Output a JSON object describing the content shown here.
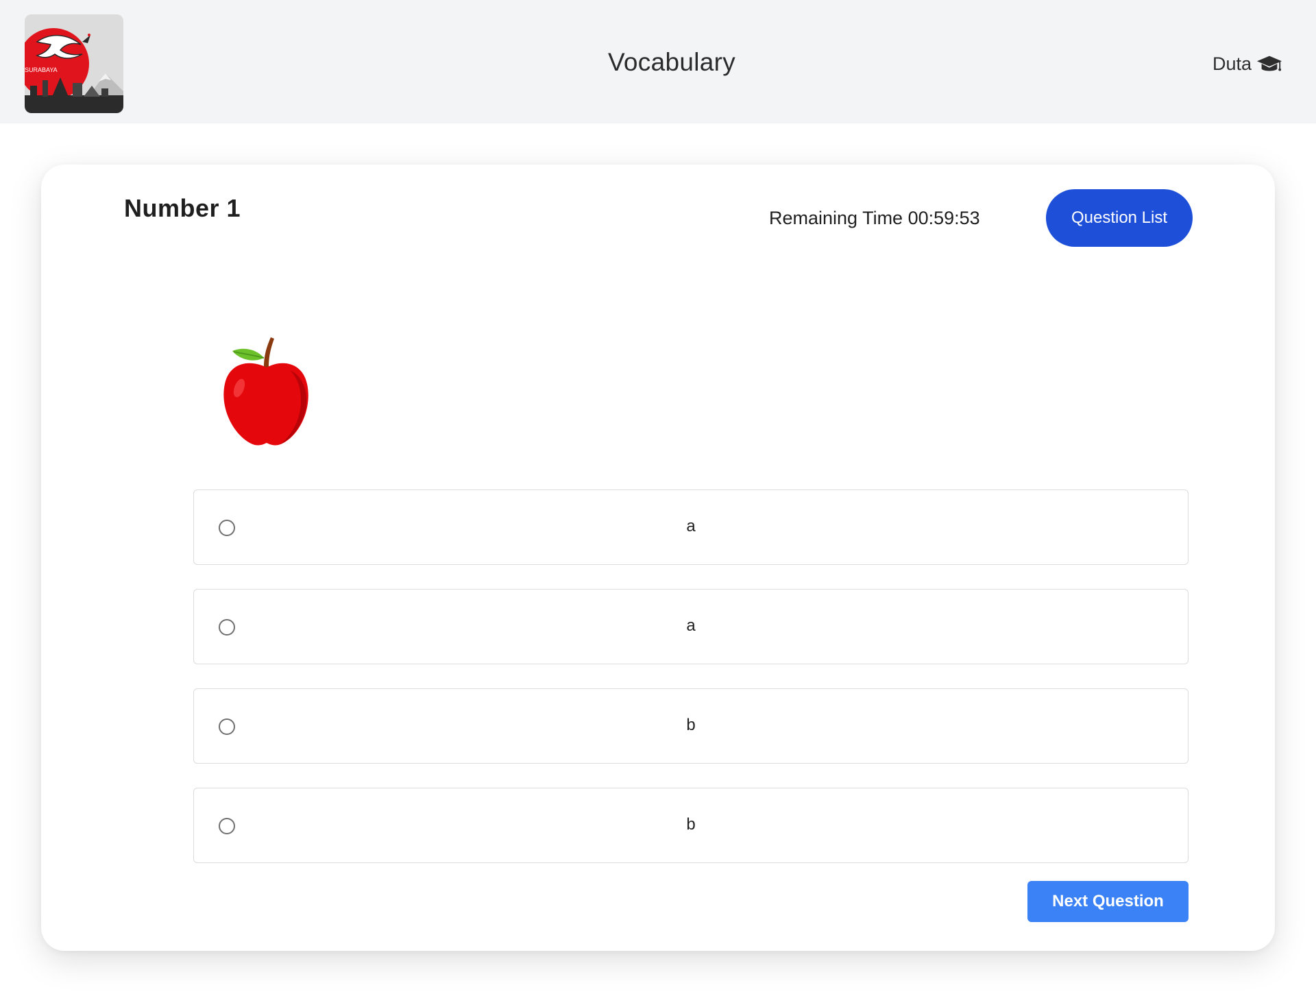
{
  "header": {
    "logo_text": "SURABAYA",
    "title": "Vocabulary",
    "user_name": "Duta",
    "user_icon": "graduation-cap-icon"
  },
  "quiz": {
    "number_label": "Number 1",
    "timer_label": "Remaining Time 00:59:53",
    "question_list_label": "Question List",
    "image_icon": "apple-image",
    "options": [
      {
        "label": "a",
        "selected": false
      },
      {
        "label": "a",
        "selected": false
      },
      {
        "label": "b",
        "selected": false
      },
      {
        "label": "b",
        "selected": false
      }
    ],
    "next_label": "Next Question"
  },
  "colors": {
    "header_bg": "#f3f4f6",
    "question_list_button": "#1d4fd8",
    "next_button": "#3b82f6",
    "logo_sun": "#e0141c"
  }
}
